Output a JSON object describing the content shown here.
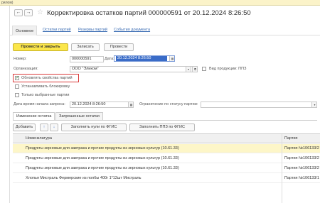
{
  "topstrip": {
    "text": "рилом)"
  },
  "window": {
    "back_glyph": "←",
    "forward_glyph": "→",
    "star_glyph": "☆",
    "title": "Корректировка остатков партий 000000591 от 20.12.2024 8:26:50"
  },
  "tabs": [
    {
      "label": "Основное"
    },
    {
      "label": "Остатки партий"
    },
    {
      "label": "Резервы партий"
    },
    {
      "label": "События документа"
    }
  ],
  "toolbar": {
    "post_close": "Провести и закрыть",
    "save": "Записать",
    "post": "Провести"
  },
  "form": {
    "number_label": "Номер:",
    "number_value": "000000591",
    "date_label": "Дата:",
    "date_value": "20.12.2024  8:26:50",
    "org_label": "Организация:",
    "org_value": "ООО \"Эликом\"",
    "product_kind_label": "Вид продукции: ППЗ",
    "update_props_label": "Обновлять свойства партий",
    "update_props_checked": true,
    "set_lock_label": "Устанавливать блокировку",
    "set_lock_checked": false,
    "selected_only_label": "Только выбранные партии",
    "selected_only_checked": false,
    "request_start_label": "Дата время начала запроса:",
    "request_start_value": "20.12.2024  8:26:50",
    "status_limit_label": "Ограничение по статусу партии:",
    "status_limit_value": ""
  },
  "subtabs": [
    {
      "label": "Изменение остатка"
    },
    {
      "label": "Запрошенные остатки"
    }
  ],
  "table_toolbar": {
    "add": "Добавить",
    "up_glyph": "↑",
    "down_glyph": "↓",
    "fill_zero": "Заполнить нули по ФГИС",
    "fill_ppz": "Заполнить ППЗ по ФГИС"
  },
  "table": {
    "columns": [
      "Номенклатура",
      "Партия"
    ],
    "rows": [
      {
        "name": "Продукты зерновые для завтрака и прочие продукты из зерновых культур (10.61.33)",
        "batch": "Партия №106133/2",
        "selected": true
      },
      {
        "name": "Продукты зерновые для завтрака и прочие продукты из зерновых культур (10.61.33)",
        "batch": "Партия №106133/2",
        "selected": false
      },
      {
        "name": "Продукты зерновые для завтрака и прочие продукты из зерновых культур (10.61.33)",
        "batch": "Партия №106133/2",
        "selected": false
      },
      {
        "name": "Хлопья Мистраль Фермерские из полбы 400г 1*12шт Мистраль",
        "batch": "Партия №106133/1",
        "selected": false
      }
    ]
  },
  "colors": {
    "primary": "#fbe64a",
    "link": "#3a6cb3",
    "highlight": "#d93b3b",
    "selected_row": "#fdf6c8"
  }
}
